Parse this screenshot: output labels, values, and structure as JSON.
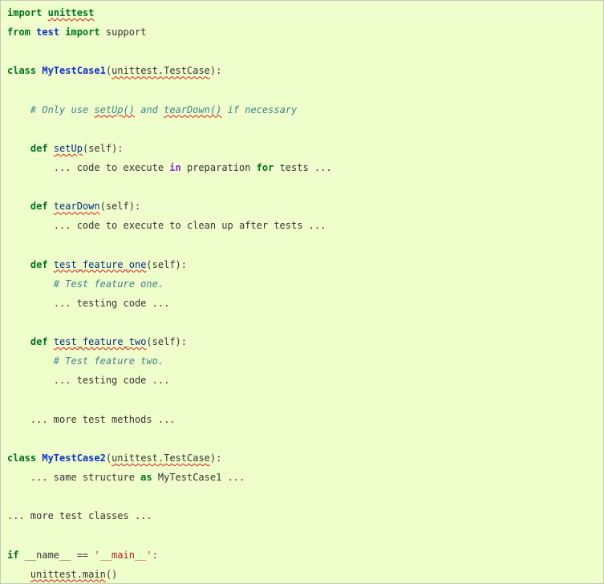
{
  "lines": [
    {
      "tokens": [
        {
          "t": "import",
          "c": "k"
        },
        {
          "t": " "
        },
        {
          "t": "unittest",
          "c": "k",
          "sq": true
        }
      ]
    },
    {
      "tokens": [
        {
          "t": "from",
          "c": "k"
        },
        {
          "t": " "
        },
        {
          "t": "test",
          "c": "nc2"
        },
        {
          "t": " "
        },
        {
          "t": "import",
          "c": "k"
        },
        {
          "t": " support"
        }
      ]
    },
    {
      "tokens": []
    },
    {
      "tokens": [
        {
          "t": "class",
          "c": "k"
        },
        {
          "t": " "
        },
        {
          "t": "MyTestCase1",
          "c": "nc2"
        },
        {
          "t": "("
        },
        {
          "t": "unittest.TestCase",
          "sq": true
        },
        {
          "t": "):"
        }
      ]
    },
    {
      "tokens": []
    },
    {
      "tokens": [
        {
          "t": "    "
        },
        {
          "t": "# Only use ",
          "c": "c"
        },
        {
          "t": "setUp()",
          "c": "c",
          "sq": true
        },
        {
          "t": " and ",
          "c": "c"
        },
        {
          "t": "tearDown()",
          "c": "c",
          "sq": true
        },
        {
          "t": " if necessary",
          "c": "c"
        }
      ]
    },
    {
      "tokens": []
    },
    {
      "tokens": [
        {
          "t": "    "
        },
        {
          "t": "def",
          "c": "k"
        },
        {
          "t": " "
        },
        {
          "t": "setUp",
          "c": "nf",
          "sq": true
        },
        {
          "t": "(self):"
        }
      ]
    },
    {
      "tokens": [
        {
          "t": "        ... code to execute "
        },
        {
          "t": "in",
          "c": "ow"
        },
        {
          "t": " preparation "
        },
        {
          "t": "for",
          "c": "k"
        },
        {
          "t": " tests ..."
        }
      ]
    },
    {
      "tokens": []
    },
    {
      "tokens": [
        {
          "t": "    "
        },
        {
          "t": "def",
          "c": "k"
        },
        {
          "t": " "
        },
        {
          "t": "tearDown",
          "c": "nf",
          "sq": true
        },
        {
          "t": "(self):"
        }
      ]
    },
    {
      "tokens": [
        {
          "t": "        ... code to execute to clean up after tests ..."
        }
      ]
    },
    {
      "tokens": []
    },
    {
      "tokens": [
        {
          "t": "    "
        },
        {
          "t": "def",
          "c": "k"
        },
        {
          "t": " "
        },
        {
          "t": "test_feature_one",
          "c": "nf",
          "sq": true
        },
        {
          "t": "(self):"
        }
      ]
    },
    {
      "tokens": [
        {
          "t": "        "
        },
        {
          "t": "# Test feature one.",
          "c": "c"
        }
      ]
    },
    {
      "tokens": [
        {
          "t": "        ... testing code ..."
        }
      ]
    },
    {
      "tokens": []
    },
    {
      "tokens": [
        {
          "t": "    "
        },
        {
          "t": "def",
          "c": "k"
        },
        {
          "t": " "
        },
        {
          "t": "test_feature_two",
          "c": "nf",
          "sq": true
        },
        {
          "t": "(self):"
        }
      ]
    },
    {
      "tokens": [
        {
          "t": "        "
        },
        {
          "t": "# Test feature two.",
          "c": "c"
        }
      ]
    },
    {
      "tokens": [
        {
          "t": "        ... testing code ..."
        }
      ]
    },
    {
      "tokens": []
    },
    {
      "tokens": [
        {
          "t": "    ... more test methods ..."
        }
      ]
    },
    {
      "tokens": []
    },
    {
      "tokens": [
        {
          "t": "class",
          "c": "k"
        },
        {
          "t": " "
        },
        {
          "t": "MyTestCase2",
          "c": "nc2"
        },
        {
          "t": "("
        },
        {
          "t": "unittest.TestCase",
          "sq": true
        },
        {
          "t": "):"
        }
      ]
    },
    {
      "tokens": [
        {
          "t": "    ... same structure "
        },
        {
          "t": "as",
          "c": "k"
        },
        {
          "t": " MyTestCase1 ..."
        }
      ]
    },
    {
      "tokens": []
    },
    {
      "tokens": [
        {
          "t": "... more test classes ..."
        }
      ]
    },
    {
      "tokens": []
    },
    {
      "tokens": [
        {
          "t": "if",
          "c": "k"
        },
        {
          "t": " __name__ == "
        },
        {
          "t": "'__main__'",
          "c": "s"
        },
        {
          "t": ":"
        }
      ]
    },
    {
      "tokens": [
        {
          "t": "    "
        },
        {
          "t": "unittest.main",
          "sq": true
        },
        {
          "t": "()"
        }
      ]
    }
  ]
}
